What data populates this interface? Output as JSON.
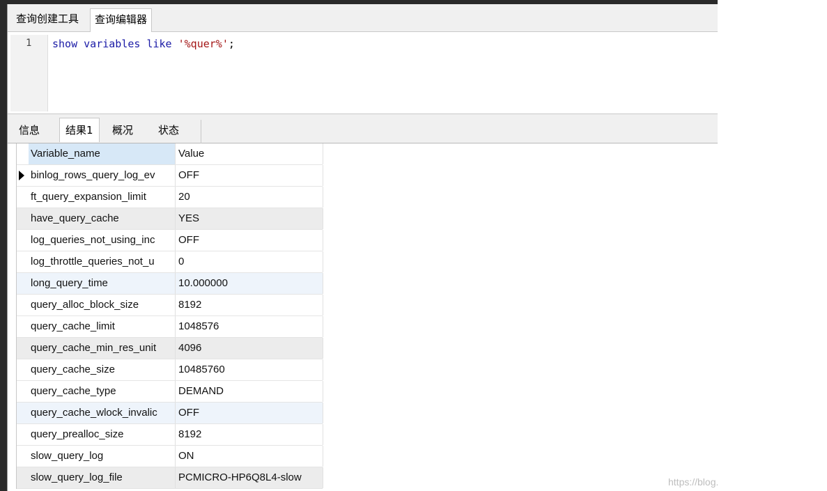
{
  "top_tabs": [
    {
      "label": "查询创建工具"
    },
    {
      "label": "查询编辑器",
      "active": true
    }
  ],
  "editor": {
    "line_number": "1",
    "code": {
      "kw1": "show",
      "kw2": "variables",
      "kw3": "like",
      "string": "'%quer%'",
      "end": ";"
    }
  },
  "result_tabs": [
    {
      "label": "信息"
    },
    {
      "label": "结果1",
      "active": true
    },
    {
      "label": "概况"
    },
    {
      "label": "状态"
    }
  ],
  "grid": {
    "columns": [
      "Variable_name",
      "Value"
    ],
    "rows": [
      {
        "name": "binlog_rows_query_log_ev",
        "value": "OFF",
        "current": true
      },
      {
        "name": "ft_query_expansion_limit",
        "value": "20"
      },
      {
        "name": "have_query_cache",
        "value": "YES"
      },
      {
        "name": "log_queries_not_using_inc",
        "value": "OFF"
      },
      {
        "name": "log_throttle_queries_not_u",
        "value": "0"
      },
      {
        "name": "long_query_time",
        "value": "10.000000"
      },
      {
        "name": "query_alloc_block_size",
        "value": "8192"
      },
      {
        "name": "query_cache_limit",
        "value": "1048576"
      },
      {
        "name": "query_cache_min_res_unit",
        "value": "4096"
      },
      {
        "name": "query_cache_size",
        "value": "10485760"
      },
      {
        "name": "query_cache_type",
        "value": "DEMAND"
      },
      {
        "name": "query_cache_wlock_invalic",
        "value": "OFF"
      },
      {
        "name": "query_prealloc_size",
        "value": "8192"
      },
      {
        "name": "slow_query_log",
        "value": "ON"
      },
      {
        "name": "slow_query_log_file",
        "value": "PCMICRO-HP6Q8L4-slow"
      }
    ]
  },
  "row_tints": [
    "#ffffff",
    "#ffffff",
    "#ececec",
    "#ffffff",
    "#ffffff",
    "#eef4fb",
    "#ffffff",
    "#ffffff",
    "#ececec",
    "#ffffff",
    "#ffffff",
    "#eef4fb",
    "#ffffff",
    "#ffffff",
    "#ececec"
  ],
  "watermark": "https://blog.csdn.net/manba_yqq"
}
